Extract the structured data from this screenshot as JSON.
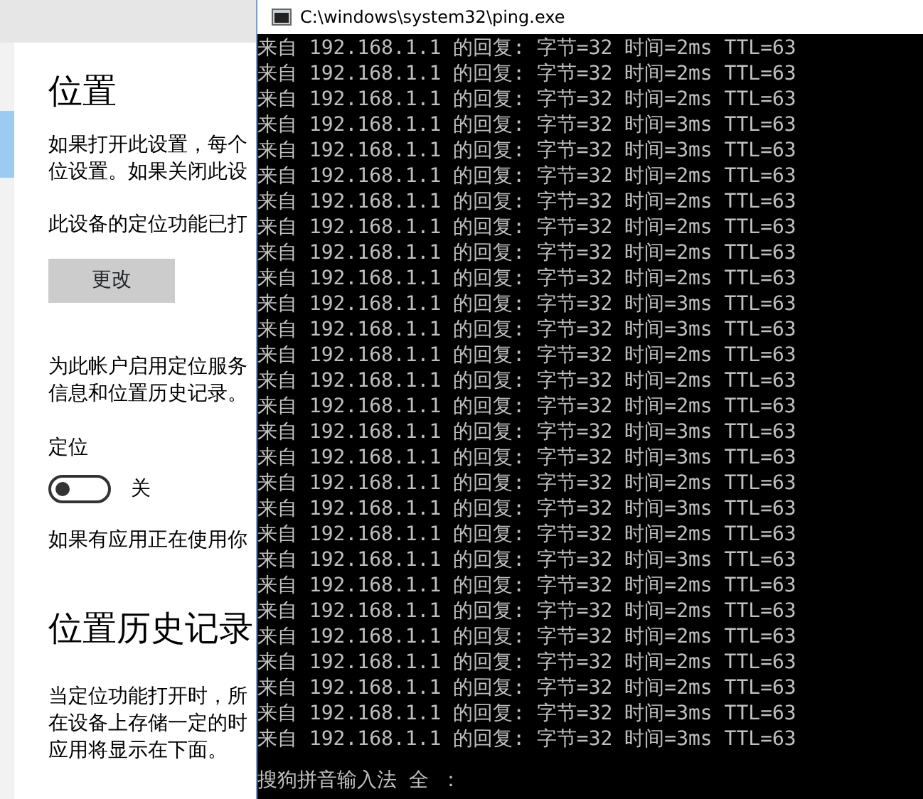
{
  "settings": {
    "items": [
      {
        "kind": "heading",
        "text": "位置"
      },
      {
        "kind": "paragraph",
        "lines": [
          "如果打开此设置，每个",
          "位设置。如果关闭此设"
        ]
      },
      {
        "kind": "paragraph",
        "lines": [
          "此设备的定位功能已打"
        ]
      },
      {
        "kind": "button",
        "text": "更改"
      },
      {
        "kind": "paragraph",
        "lines": [
          "为此帐户启用定位服务",
          "信息和位置历史记录。"
        ]
      },
      {
        "kind": "label",
        "text": "定位"
      },
      {
        "kind": "toggle",
        "on": false,
        "text": "关"
      },
      {
        "kind": "paragraph",
        "lines": [
          "如果有应用正在使用你"
        ]
      },
      {
        "kind": "heading",
        "text": "位置历史记录"
      },
      {
        "kind": "paragraph",
        "lines": [
          "当定位功能打开时，所",
          "在设备上存储一定的时",
          "应用将显示在下面。"
        ]
      }
    ]
  },
  "console": {
    "title": "C:\\windows\\system32\\ping.exe",
    "lines": [
      "来自 192.168.1.1 的回复: 字节=32 时间=2ms TTL=63",
      "来自 192.168.1.1 的回复: 字节=32 时间=2ms TTL=63",
      "来自 192.168.1.1 的回复: 字节=32 时间=2ms TTL=63",
      "来自 192.168.1.1 的回复: 字节=32 时间=3ms TTL=63",
      "来自 192.168.1.1 的回复: 字节=32 时间=3ms TTL=63",
      "来自 192.168.1.1 的回复: 字节=32 时间=2ms TTL=63",
      "来自 192.168.1.1 的回复: 字节=32 时间=2ms TTL=63",
      "来自 192.168.1.1 的回复: 字节=32 时间=2ms TTL=63",
      "来自 192.168.1.1 的回复: 字节=32 时间=2ms TTL=63",
      "来自 192.168.1.1 的回复: 字节=32 时间=2ms TTL=63",
      "来自 192.168.1.1 的回复: 字节=32 时间=3ms TTL=63",
      "来自 192.168.1.1 的回复: 字节=32 时间=3ms TTL=63",
      "来自 192.168.1.1 的回复: 字节=32 时间=2ms TTL=63",
      "来自 192.168.1.1 的回复: 字节=32 时间=2ms TTL=63",
      "来自 192.168.1.1 的回复: 字节=32 时间=2ms TTL=63",
      "来自 192.168.1.1 的回复: 字节=32 时间=3ms TTL=63",
      "来自 192.168.1.1 的回复: 字节=32 时间=3ms TTL=63",
      "来自 192.168.1.1 的回复: 字节=32 时间=2ms TTL=63",
      "来自 192.168.1.1 的回复: 字节=32 时间=3ms TTL=63",
      "来自 192.168.1.1 的回复: 字节=32 时间=2ms TTL=63",
      "来自 192.168.1.1 的回复: 字节=32 时间=3ms TTL=63",
      "来自 192.168.1.1 的回复: 字节=32 时间=2ms TTL=63",
      "来自 192.168.1.1 的回复: 字节=32 时间=2ms TTL=63",
      "来自 192.168.1.1 的回复: 字节=32 时间=2ms TTL=63",
      "来自 192.168.1.1 的回复: 字节=32 时间=2ms TTL=63",
      "来自 192.168.1.1 的回复: 字节=32 时间=2ms TTL=63",
      "来自 192.168.1.1 的回复: 字节=32 时间=3ms TTL=63",
      "来自 192.168.1.1 的回复: 字节=32 时间=3ms TTL=63"
    ],
    "ime_status": "搜狗拼音输入法 全 ："
  }
}
